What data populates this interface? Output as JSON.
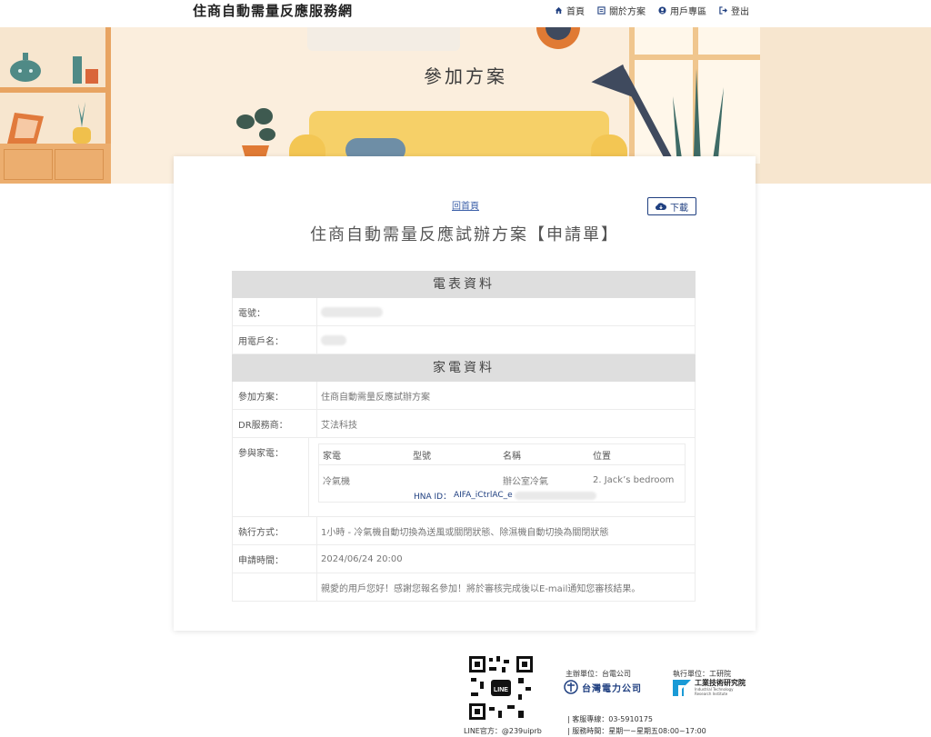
{
  "site": {
    "brand": "住商自動需量反應服務網"
  },
  "nav": [
    {
      "label": "首頁",
      "icon": "home-icon"
    },
    {
      "label": "關於方案",
      "icon": "list-icon"
    },
    {
      "label": "用戶專區",
      "icon": "user-icon"
    },
    {
      "label": "登出",
      "icon": "logout-icon"
    }
  ],
  "hero": {
    "title": "參加方案"
  },
  "card": {
    "back_link": "回首頁",
    "download_label": "下載",
    "title": "住商自動需量反應試辦方案【申請單】"
  },
  "meter": {
    "section_title": "電表資料",
    "account_label": "電號：",
    "name_label": "用電戶名："
  },
  "appliance": {
    "section_title": "家電資料",
    "plan_label": "參加方案：",
    "plan_value": "住商自動需量反應試辦方案",
    "dr_label": "DR服務商：",
    "dr_value": "艾法科技",
    "devices_label": "參與家電：",
    "table_headers": [
      "家電",
      "型號",
      "名稱",
      "位置"
    ],
    "table_rows": [
      {
        "type": "冷氣機",
        "model": "",
        "name": "辦公室冷氣",
        "location": "2. Jack’s bedroom"
      }
    ],
    "hna_label": "HNA ID：",
    "hna_value": "AIFA_iCtrlAC_e",
    "method_label": "執行方式：",
    "method_value": "1小時 - 冷氣機自動切換為送風或關閉狀態、除濕機自動切換為關閉狀態",
    "time_label": "申請時間：",
    "time_value": "2024/06/24 20:00",
    "message": "親愛的用戶您好！感謝您報名參加！將於審核完成後以E-mail通知您審核結果。"
  },
  "footer": {
    "line_label": "LINE官方：@239uiprb",
    "host_label": "主辦單位：台電公司",
    "host_logo_text": "台灣電力公司",
    "exec_label": "執行單位：工研院",
    "exec_logo_text": "工業技術研究院",
    "exec_logo_sub": "Industrial Technology Research Institute",
    "hotline": "| 客服專線：03-5910175",
    "hours": "| 服務時間：星期一~星期五08:00~17:00",
    "qr_center": "LINE"
  },
  "colors": {
    "accent": "#1f3f80",
    "section_bg": "#dedede",
    "hero_bg": "#f7e6cf"
  }
}
